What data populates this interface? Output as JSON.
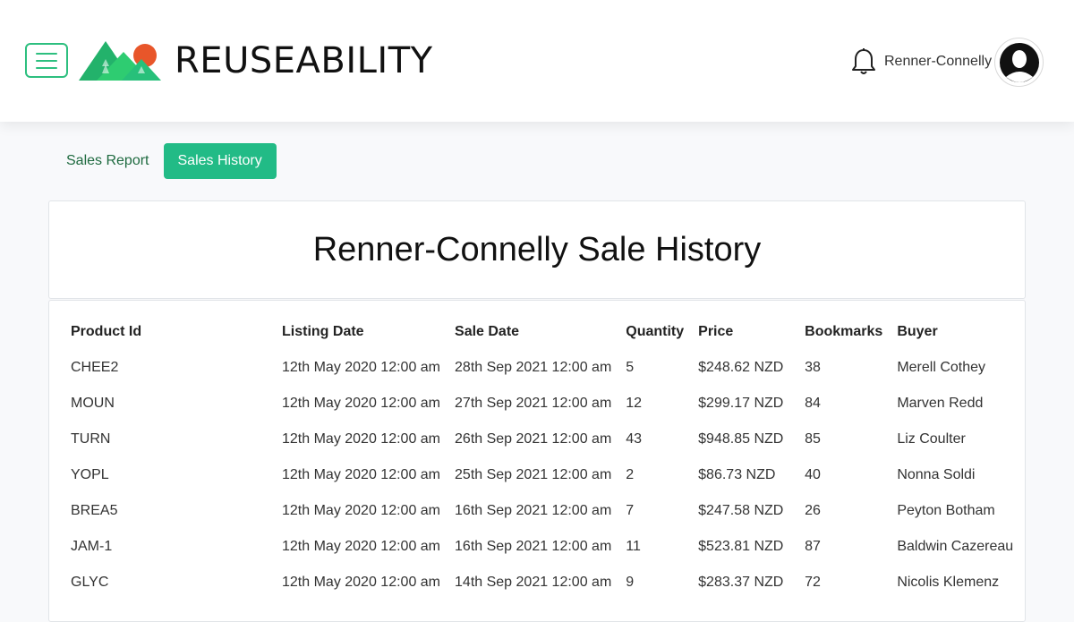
{
  "header": {
    "brand": "REUSEABILITY",
    "user_name": "Renner-Connelly",
    "icons": {
      "menu": "hamburger-menu-icon",
      "bell": "bell-icon",
      "avatar": "user-avatar-icon"
    },
    "colors": {
      "accent": "#2dbf7f",
      "logo_green": "#2ecc71",
      "logo_sun": "#e8562a"
    }
  },
  "tabs": [
    {
      "label": "Sales Report",
      "active": false
    },
    {
      "label": "Sales History",
      "active": true
    }
  ],
  "page_title": "Renner-Connelly Sale History",
  "table": {
    "columns": [
      "Product Id",
      "Listing Date",
      "Sale Date",
      "Quantity",
      "Price",
      "Bookmarks",
      "Buyer"
    ],
    "rows": [
      [
        "CHEE2",
        "12th May 2020 12:00 am",
        "28th Sep 2021 12:00 am",
        "5",
        "$248.62 NZD",
        "38",
        "Merell Cothey"
      ],
      [
        "MOUN",
        "12th May 2020 12:00 am",
        "27th Sep 2021 12:00 am",
        "12",
        "$299.17 NZD",
        "84",
        "Marven Redd"
      ],
      [
        "TURN",
        "12th May 2020 12:00 am",
        "26th Sep 2021 12:00 am",
        "43",
        "$948.85 NZD",
        "85",
        "Liz Coulter"
      ],
      [
        "YOPL",
        "12th May 2020 12:00 am",
        "25th Sep 2021 12:00 am",
        "2",
        "$86.73 NZD",
        "40",
        "Nonna Soldi"
      ],
      [
        "BREA5",
        "12th May 2020 12:00 am",
        "16th Sep 2021 12:00 am",
        "7",
        "$247.58 NZD",
        "26",
        "Peyton Botham"
      ],
      [
        "JAM-1",
        "12th May 2020 12:00 am",
        "16th Sep 2021 12:00 am",
        "11",
        "$523.81 NZD",
        "87",
        "Baldwin Cazereau"
      ],
      [
        "GLYC",
        "12th May 2020 12:00 am",
        "14th Sep 2021 12:00 am",
        "9",
        "$283.37 NZD",
        "72",
        "Nicolis Klemenz"
      ]
    ]
  }
}
